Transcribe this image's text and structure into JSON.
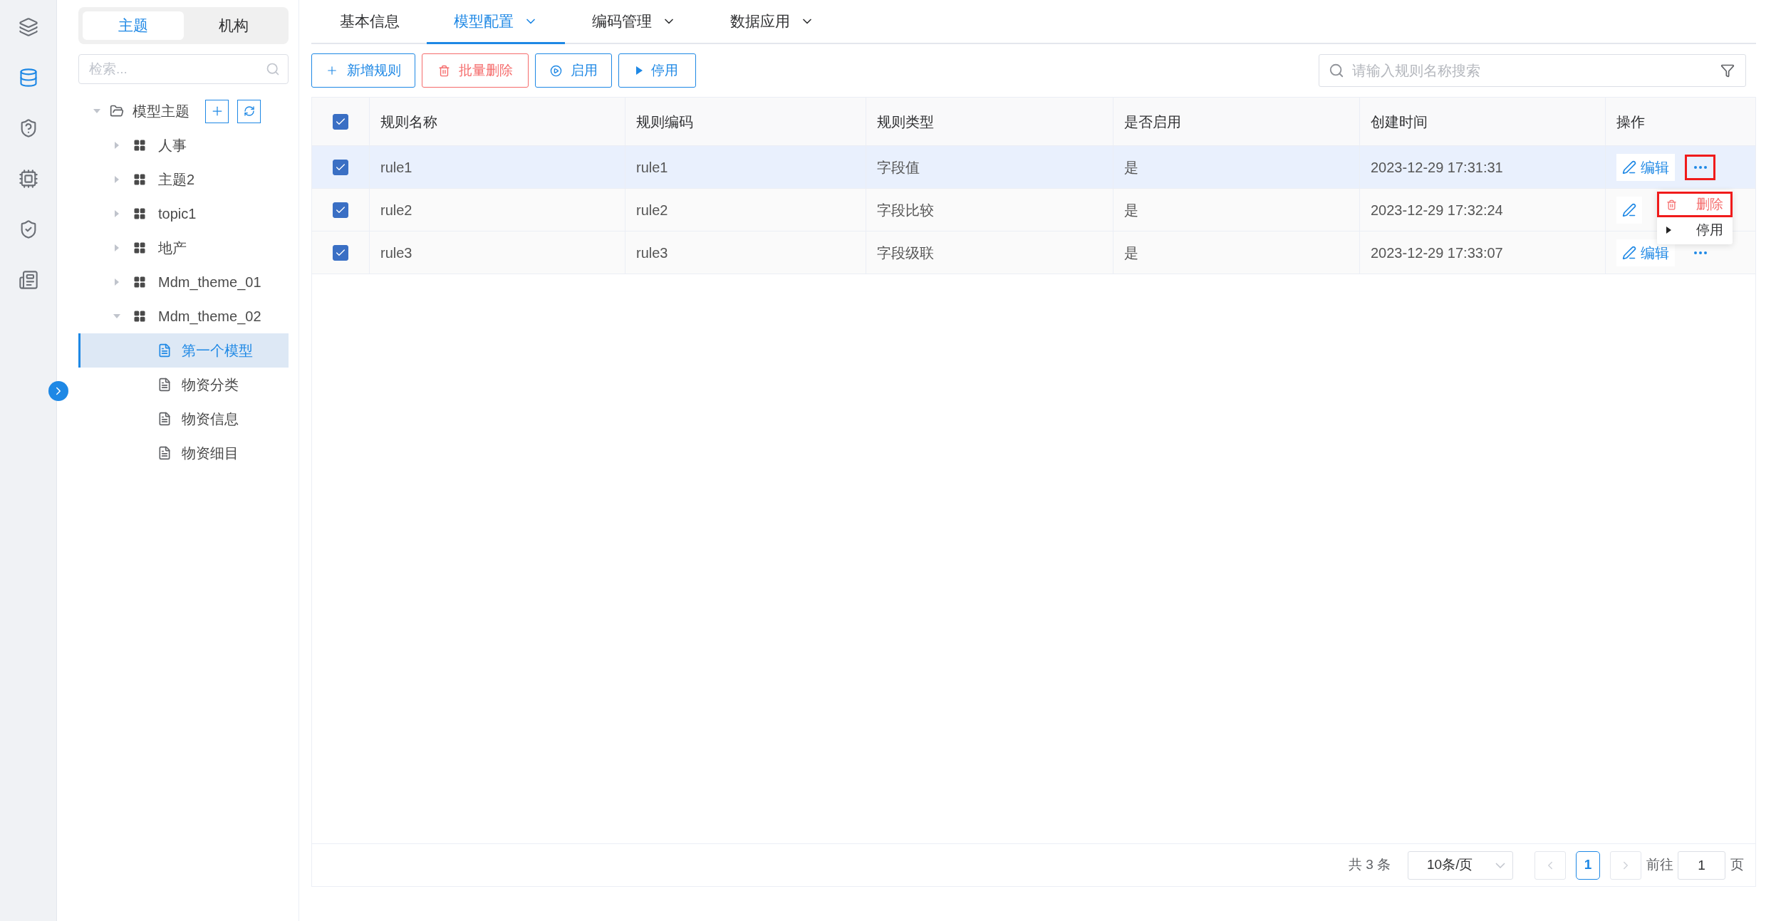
{
  "nav_rail": {
    "items": [
      {
        "kind": "layers",
        "selected": false
      },
      {
        "kind": "database",
        "selected": true
      },
      {
        "kind": "shield",
        "selected": false
      },
      {
        "kind": "chip",
        "selected": false
      },
      {
        "kind": "shield_check",
        "selected": false
      },
      {
        "kind": "document",
        "selected": false
      }
    ]
  },
  "sidebar": {
    "tabs": [
      {
        "label": "主题",
        "selected": true
      },
      {
        "label": "机构",
        "selected": false
      }
    ],
    "search": {
      "placeholder": "检索..."
    },
    "tree": {
      "label": "模型主题",
      "expanded": true,
      "children": [
        {
          "label": "人事",
          "expanded": false
        },
        {
          "label": "主题2",
          "expanded": false
        },
        {
          "label": "topic1",
          "expanded": false
        },
        {
          "label": "地产",
          "expanded": false
        },
        {
          "label": "Mdm_theme_01",
          "expanded": false
        },
        {
          "label": "Mdm_theme_02",
          "expanded": true,
          "children": [
            {
              "label": "第一个模型",
              "selected": true
            },
            {
              "label": "物资分类",
              "selected": false
            },
            {
              "label": "物资信息",
              "selected": false
            },
            {
              "label": "物资细目",
              "selected": false
            }
          ]
        }
      ]
    }
  },
  "tabs": [
    {
      "label": "基本信息",
      "selected": false,
      "dropdown": false
    },
    {
      "label": "模型配置",
      "selected": true,
      "dropdown": true
    },
    {
      "label": "编码管理",
      "selected": false,
      "dropdown": true
    },
    {
      "label": "数据应用",
      "selected": false,
      "dropdown": true
    }
  ],
  "toolbar": {
    "buttons": [
      {
        "label": "新增规则",
        "kind": "add"
      },
      {
        "label": "批量删除",
        "kind": "delete"
      },
      {
        "label": "启用",
        "kind": "enable"
      },
      {
        "label": "停用",
        "kind": "disable"
      }
    ],
    "search": {
      "placeholder": "请输入规则名称搜索"
    }
  },
  "table": {
    "header_checked": true,
    "columns": [
      "规则名称",
      "规则编码",
      "规则类型",
      "是否启用",
      "创建时间",
      "操作"
    ],
    "rows": [
      {
        "checked": true,
        "selected": true,
        "cells": [
          "rule1",
          "rule1",
          "字段值",
          "是",
          "2023-12-29 17:31:31"
        ],
        "edit_label": "编辑",
        "more_highlighted": true
      },
      {
        "checked": true,
        "selected": false,
        "cells": [
          "rule2",
          "rule2",
          "字段比较",
          "是",
          "2023-12-29 17:32:24"
        ]
      },
      {
        "checked": true,
        "selected": false,
        "cells": [
          "rule3",
          "rule3",
          "字段级联",
          "是",
          "2023-12-29 17:33:07"
        ],
        "edit_label": "编辑",
        "more_highlighted": false
      }
    ]
  },
  "row_menu": {
    "items": [
      {
        "label": "删除",
        "kind": "delete",
        "highlighted": true
      },
      {
        "label": "停用",
        "kind": "disable",
        "highlighted": false
      }
    ]
  },
  "pagination": {
    "total": "共 3 条",
    "page_size": "10条/页",
    "pages": [
      {
        "label": "1",
        "selected": true
      }
    ],
    "goto_label": "前往",
    "goto_value": "1",
    "page_suffix": "页"
  }
}
